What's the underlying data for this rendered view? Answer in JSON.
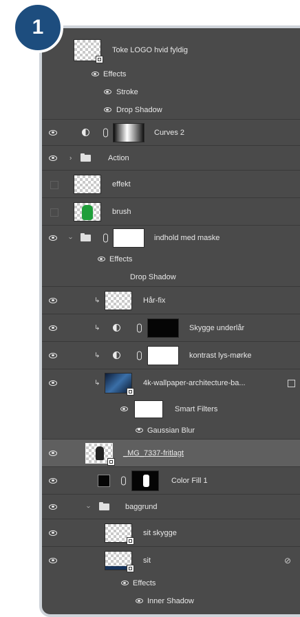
{
  "step_badge": "1",
  "layers": [
    {
      "name": "Toke LOGO hvid fyldig"
    },
    {
      "effects_label": "Effects"
    },
    {
      "stroke_label": "Stroke"
    },
    {
      "drop_shadow_label": "Drop Shadow"
    },
    {
      "name": "Curves 2"
    },
    {
      "name": "Action"
    },
    {
      "name": "effekt"
    },
    {
      "name": "brush"
    },
    {
      "name": "indhold med maske"
    },
    {
      "effects_label": "Effects"
    },
    {
      "drop_shadow_label": "Drop Shadow"
    },
    {
      "name": "Hår-fix"
    },
    {
      "name": "Skygge underlår"
    },
    {
      "name": "kontrast lys-mørke"
    },
    {
      "name": "4k-wallpaper-architecture-ba..."
    },
    {
      "smart_filters_label": "Smart Filters"
    },
    {
      "gaussian_label": "Gaussian Blur"
    },
    {
      "name": "_MG_7337-fritlagt"
    },
    {
      "name": "Color Fill 1"
    },
    {
      "name": "baggrund"
    },
    {
      "name": "sit skygge"
    },
    {
      "name": "sit"
    },
    {
      "effects_label": "Effects"
    },
    {
      "inner_shadow_label": "Inner Shadow"
    }
  ]
}
